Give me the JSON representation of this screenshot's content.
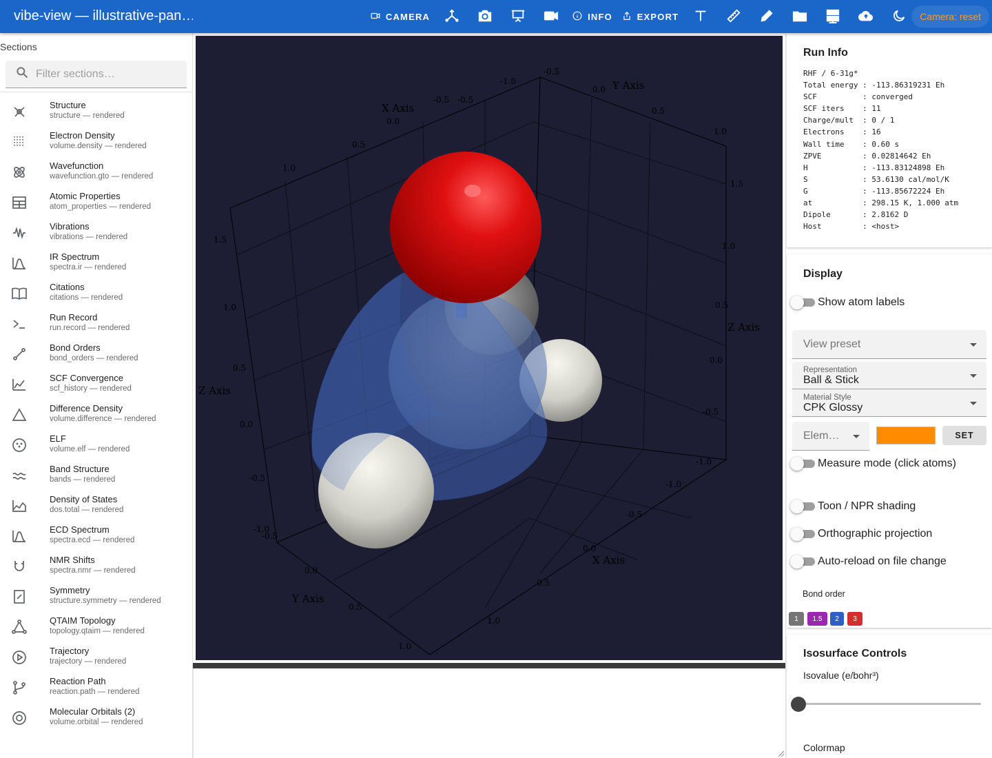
{
  "app": {
    "title": "vibe-view — illustrative-pan…"
  },
  "toolbar": {
    "camera_label": "CAMERA",
    "info_label": "INFO",
    "export_label": "EXPORT",
    "camera_status": "Camera: reset"
  },
  "sidebar": {
    "heading": "Sections",
    "filter_placeholder": "Filter sections…",
    "items": [
      {
        "title": "Structure",
        "sub": "structure — rendered",
        "icon": "structure-icon"
      },
      {
        "title": "Electron Density",
        "sub": "volume.density — rendered",
        "icon": "grid-dots-icon"
      },
      {
        "title": "Wavefunction",
        "sub": "wavefunction.gto — rendered",
        "icon": "atom-icon"
      },
      {
        "title": "Atomic Properties",
        "sub": "atom_properties — rendered",
        "icon": "table-icon"
      },
      {
        "title": "Vibrations",
        "sub": "vibrations — rendered",
        "icon": "waveform-icon"
      },
      {
        "title": "IR Spectrum",
        "sub": "spectra.ir — rendered",
        "icon": "spectrum-icon"
      },
      {
        "title": "Citations",
        "sub": "citations — rendered",
        "icon": "book-icon"
      },
      {
        "title": "Run Record",
        "sub": "run.record — rendered",
        "icon": "terminal-icon"
      },
      {
        "title": "Bond Orders",
        "sub": "bond_orders — rendered",
        "icon": "bond-icon"
      },
      {
        "title": "SCF Convergence",
        "sub": "scf_history — rendered",
        "icon": "line-chart-icon"
      },
      {
        "title": "Difference Density",
        "sub": "volume.difference — rendered",
        "icon": "triangle-icon"
      },
      {
        "title": "ELF",
        "sub": "volume.elf — rendered",
        "icon": "dotted-circle-icon"
      },
      {
        "title": "Band Structure",
        "sub": "bands — rendered",
        "icon": "bands-icon"
      },
      {
        "title": "Density of States",
        "sub": "dos.total — rendered",
        "icon": "area-chart-icon"
      },
      {
        "title": "ECD Spectrum",
        "sub": "spectra.ecd — rendered",
        "icon": "spectrum-icon"
      },
      {
        "title": "NMR Shifts",
        "sub": "spectra.nmr — rendered",
        "icon": "magnet-icon"
      },
      {
        "title": "Symmetry",
        "sub": "structure.symmetry — rendered",
        "icon": "symmetry-icon"
      },
      {
        "title": "QTAIM Topology",
        "sub": "topology.qtaim — rendered",
        "icon": "graph-icon"
      },
      {
        "title": "Trajectory",
        "sub": "trajectory — rendered",
        "icon": "play-circle-icon"
      },
      {
        "title": "Reaction Path",
        "sub": "reaction.path — rendered",
        "icon": "branch-icon"
      },
      {
        "title": "Molecular Orbitals (2)",
        "sub": "volume.orbital — rendered",
        "icon": "orbital-icon"
      }
    ]
  },
  "viewer": {
    "axis_titles": {
      "x_top": "X Axis",
      "y_top": "Y Axis",
      "z_left": "Z Axis",
      "z_right": "Z Axis",
      "x_bottom": "X Axis",
      "y_bottom": "Y Axis"
    },
    "ticks": {
      "x_top": [
        "-0.5",
        "0.0",
        "0.5",
        "1.0"
      ],
      "y_top": [
        "-0.5",
        "-1.0",
        "-0.5",
        "0.0",
        "0.5",
        "1.0"
      ],
      "z_left": [
        "1.5",
        "1.0",
        "0.5",
        "0.0",
        "-0.5",
        "-1.0"
      ],
      "z_right": [
        "1.5",
        "1.0",
        "0.5",
        "0.0",
        "-0.5",
        "-1.0"
      ],
      "x_bottom": [
        "-1.0",
        "-0.5",
        "0.0",
        "0.5",
        "1.0"
      ],
      "y_bottom": [
        "-0.5",
        "0.0",
        "0.5",
        "1.0"
      ]
    }
  },
  "run_info": {
    "title": "Run Info",
    "text": "RHF / 6-31g*\nTotal energy : -113.86319231 Eh\nSCF          : converged\nSCF iters    : 11\nCharge/mult  : 0 / 1\nElectrons    : 16\nWall time    : 0.60 s\nZPVE         : 0.02814642 Eh\nH            : -113.83124898 Eh\nS            : 53.6130 cal/mol/K\nG            : -113.85672224 Eh\nat           : 298.15 K, 1.000 atm\nDipole       : 2.8162 D\nHost         : <host>"
  },
  "display": {
    "title": "Display",
    "show_atom_labels": "Show atom labels",
    "view_preset": "View preset",
    "representation_label": "Representation",
    "representation_value": "Ball & Stick",
    "material_label": "Material Style",
    "material_value": "CPK Glossy",
    "element_placeholder": "Elem…",
    "element_color": "#ff8c00",
    "set_label": "SET",
    "measure_mode": "Measure mode (click atoms)",
    "toon": "Toon / NPR shading",
    "ortho": "Orthographic projection",
    "autoreload": "Auto-reload on file change",
    "bond_order_label": "Bond order",
    "bond_orders": [
      {
        "label": "1",
        "color": "#757575"
      },
      {
        "label": "1.5",
        "color": "#9c27b0"
      },
      {
        "label": "2",
        "color": "#2f5fc4"
      },
      {
        "label": "3",
        "color": "#d32f2f"
      }
    ]
  },
  "isosurface": {
    "title": "Isosurface Controls",
    "isovalue_label": "Isovalue (e/bohr³)",
    "colormap_label": "Colormap"
  }
}
